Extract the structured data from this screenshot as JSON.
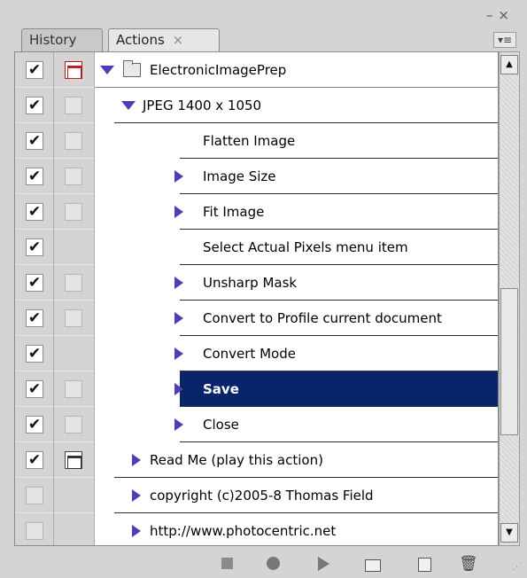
{
  "window": {
    "min_glyph": "–",
    "close_glyph": "×"
  },
  "tabs": [
    {
      "label": "History"
    },
    {
      "label": "Actions",
      "close": "×"
    }
  ],
  "panel_menu_glyph": "▾≡",
  "rows": [
    {
      "label": "ElectronicImagePrep",
      "type": "set",
      "checked": true,
      "dialog": "red",
      "expanded": true
    },
    {
      "label": "JPEG 1400 x 1050",
      "type": "action",
      "checked": true,
      "dialog": "empty",
      "expanded": true
    },
    {
      "label": "Flatten Image",
      "type": "cmd",
      "checked": true,
      "dialog": "empty",
      "expander": false
    },
    {
      "label": "Image Size",
      "type": "cmd",
      "checked": true,
      "dialog": "empty",
      "expander": true
    },
    {
      "label": "Fit Image",
      "type": "cmd",
      "checked": true,
      "dialog": "empty",
      "expander": true
    },
    {
      "label": "Select Actual Pixels menu item",
      "type": "cmd",
      "checked": true,
      "dialog": "none",
      "expander": false
    },
    {
      "label": "Unsharp Mask",
      "type": "cmd",
      "checked": true,
      "dialog": "empty",
      "expander": true
    },
    {
      "label": "Convert to Profile current document",
      "type": "cmd",
      "checked": true,
      "dialog": "empty",
      "expander": true
    },
    {
      "label": "Convert Mode",
      "type": "cmd",
      "checked": true,
      "dialog": "none",
      "expander": true
    },
    {
      "label": "Save",
      "type": "cmd",
      "checked": true,
      "dialog": "empty",
      "expander": true,
      "selected": true
    },
    {
      "label": "Close",
      "type": "cmd",
      "checked": true,
      "dialog": "empty",
      "expander": true
    },
    {
      "label": "Read Me (play this action)",
      "type": "lower",
      "checked": true,
      "dialog": "dark",
      "expander": true
    },
    {
      "label": "copyright (c)2005-8 Thomas Field",
      "type": "lower",
      "checked": false,
      "dialog": "none",
      "expander": true
    },
    {
      "label": "http://www.photocentric.net",
      "type": "lower",
      "checked": false,
      "dialog": "none",
      "expander": true
    }
  ],
  "footer_buttons": [
    "stop-playing",
    "begin-recording",
    "play-selection",
    "create-new-set",
    "create-new-action",
    "delete"
  ],
  "scroll": {
    "up_glyph": "▲",
    "down_glyph": "▼"
  },
  "check_glyph": "✔",
  "trash_glyph": "🗑",
  "grip_glyph": "⋰"
}
